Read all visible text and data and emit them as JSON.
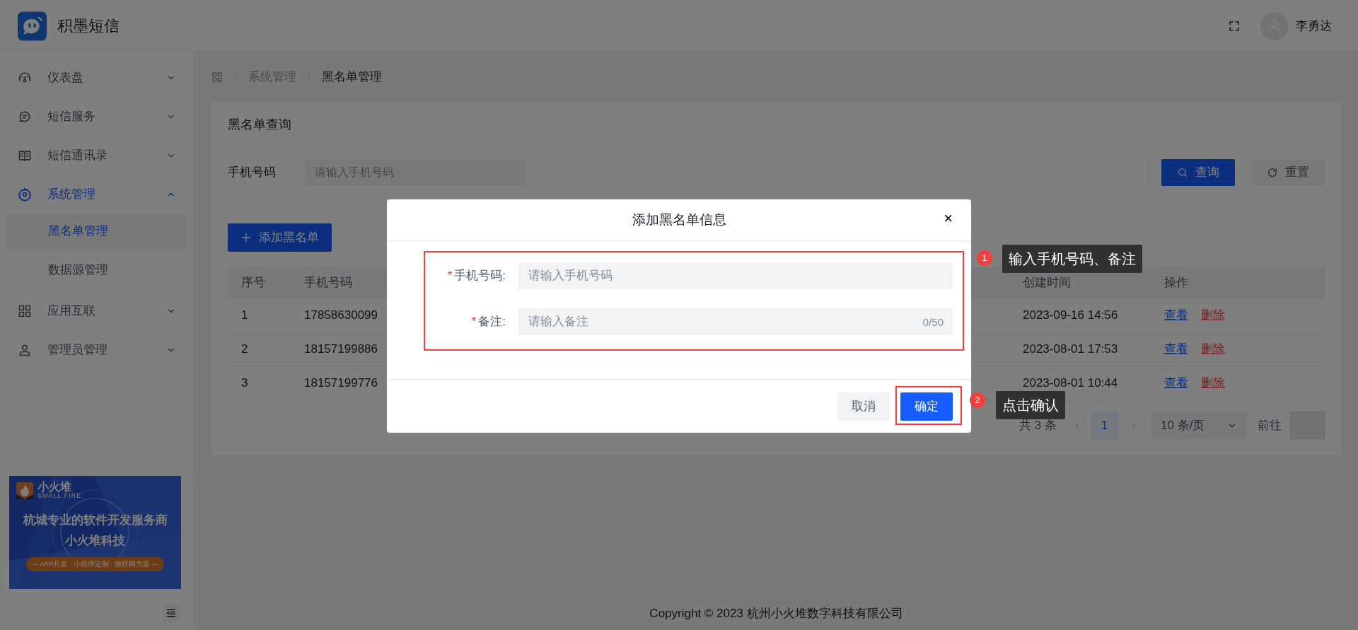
{
  "header": {
    "app_name": "积墨短信",
    "user_name": "李勇达"
  },
  "sidebar": {
    "items": [
      {
        "label": "仪表盘",
        "selected": false,
        "expanded": false
      },
      {
        "label": "短信服务",
        "selected": false,
        "expanded": false
      },
      {
        "label": "短信通讯录",
        "selected": false,
        "expanded": false
      },
      {
        "label": "系统管理",
        "selected": true,
        "expanded": true,
        "children": [
          {
            "label": "黑名单管理",
            "selected": true
          },
          {
            "label": "数据源管理",
            "selected": false
          }
        ]
      },
      {
        "label": "应用互联",
        "selected": false,
        "expanded": false
      },
      {
        "label": "管理员管理",
        "selected": false,
        "expanded": false
      }
    ]
  },
  "banner": {
    "brand": "小火堆",
    "brand_sub": "SMALL FIRE",
    "headline": "杭城专业的软件开发服务商",
    "subline": "小火堆科技",
    "tagline": "— APP开发 · 小程序定制 · 物联网方案 —"
  },
  "breadcrumb": [
    "系统管理",
    "黑名单管理"
  ],
  "query_card": {
    "title": "黑名单查询",
    "filter_label": "手机号码",
    "placeholder": "请输入手机号码",
    "query_button": "查询",
    "reset_button": "重置"
  },
  "add_button": "添加黑名单",
  "table": {
    "columns": [
      "序号",
      "手机号码",
      "创建时间",
      "操作"
    ],
    "rows": [
      {
        "cells": [
          "1",
          "17858630099",
          "2023-09-16 14:56"
        ],
        "actions": [
          {
            "label": "查看",
            "kind": "view"
          },
          {
            "label": "删除",
            "kind": "delete"
          }
        ]
      },
      {
        "cells": [
          "2",
          "18157199886",
          "2023-08-01 17:53"
        ],
        "actions": [
          {
            "label": "查看",
            "kind": "view"
          },
          {
            "label": "删除",
            "kind": "delete"
          }
        ]
      },
      {
        "cells": [
          "3",
          "18157199776",
          "2023-08-01 10:44"
        ],
        "actions": [
          {
            "label": "查看",
            "kind": "view"
          },
          {
            "label": "删除",
            "kind": "delete"
          }
        ]
      }
    ]
  },
  "pagination": {
    "total": "共 3 条",
    "pages": [
      {
        "label": "1",
        "selected": true
      }
    ],
    "page_size": "10 条/页",
    "goto_label": "前往"
  },
  "footer": "Copyright © 2023 杭州小火堆数字科技有限公司",
  "dialog": {
    "title": "添加黑名单信息",
    "close": "×",
    "fields": [
      {
        "marker": "*",
        "label": "手机号码:",
        "placeholder": "请输入手机号码"
      },
      {
        "marker": "*",
        "label": "备注:",
        "placeholder": "请输入备注",
        "counter": "0/50"
      }
    ],
    "cancel_button": "取消",
    "confirm_button": "确定"
  },
  "annotations": [
    {
      "number": "1",
      "text": "输入手机号码、备注"
    },
    {
      "number": "2",
      "text": "点击确认"
    }
  ]
}
